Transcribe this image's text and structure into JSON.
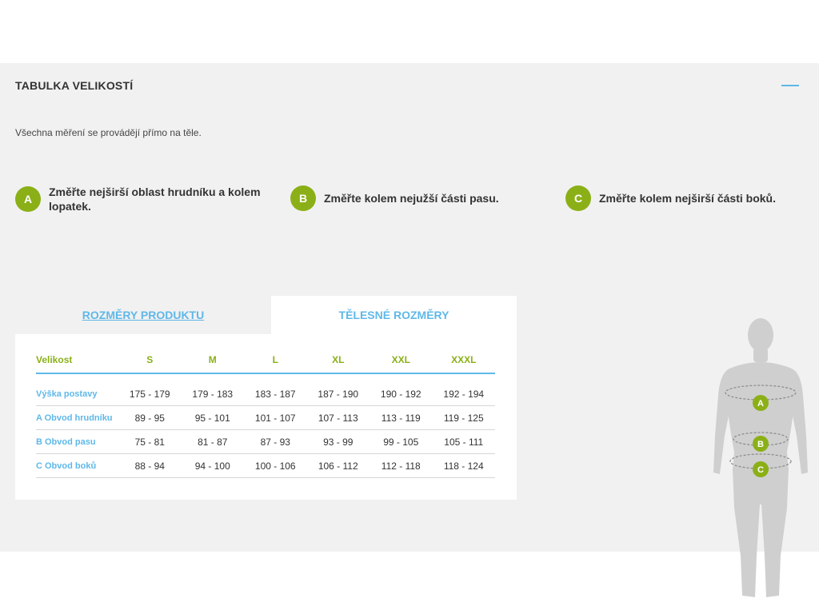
{
  "panel": {
    "title": "TABULKA VELIKOSTÍ",
    "intro": "Všechna měření se provádějí přímo na těle."
  },
  "instructions": [
    {
      "badge": "A",
      "text_line1": "Změřte nejširší oblast hrudníku a kolem",
      "text_line2": "lopatek."
    },
    {
      "badge": "B",
      "text": "Změřte kolem nejužší části pasu."
    },
    {
      "badge": "C",
      "text": "Změřte kolem nejširší části boků."
    }
  ],
  "tabs": {
    "product": "ROZMĚRY PRODUKTU",
    "body": "TĚLESNÉ ROZMĚRY"
  },
  "table": {
    "header": [
      "Velikost",
      "S",
      "M",
      "L",
      "XL",
      "XXL",
      "XXXL"
    ],
    "rows": [
      {
        "label": "Výška postavy",
        "values": [
          "175 - 179",
          "179 - 183",
          "183 - 187",
          "187 - 190",
          "190 - 192",
          "192 - 194"
        ]
      },
      {
        "label": "A Obvod hrudníku",
        "values": [
          "89 - 95",
          "95 - 101",
          "101 - 107",
          "107 - 113",
          "113 - 119",
          "119 - 125"
        ]
      },
      {
        "label": "B Obvod pasu",
        "values": [
          "75 - 81",
          "81 - 87",
          "87 - 93",
          "93 - 99",
          "99 - 105",
          "105 - 111"
        ]
      },
      {
        "label": "C Obvod boků",
        "values": [
          "88 - 94",
          "94 - 100",
          "100 - 106",
          "106 - 112",
          "112 - 118",
          "118 - 124"
        ]
      }
    ]
  },
  "figure": {
    "markers": [
      "A",
      "B",
      "C"
    ]
  },
  "colors": {
    "accent_green": "#8bb017",
    "accent_blue": "#5fb8e8",
    "panel_bg": "#f1f1f1",
    "figure_gray": "#cfcfcf"
  },
  "icons": {
    "collapse": "minus-icon",
    "figure": "human-body-figure"
  }
}
